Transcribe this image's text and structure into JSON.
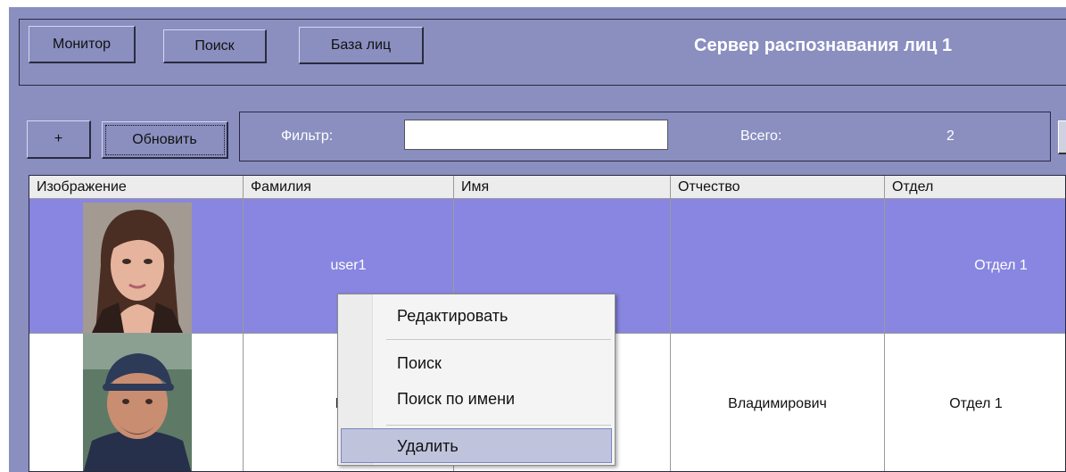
{
  "toolbar": {
    "monitor_label": "Монитор",
    "search_label": "Поиск",
    "face_db_label": "База лиц",
    "server_title": "Сервер распознавания лиц 1"
  },
  "actions": {
    "add_label": "+",
    "refresh_label": "Обновить",
    "filter_label": "Фильтр:",
    "filter_value": "",
    "total_label": "Всего:",
    "total_value": "2"
  },
  "table": {
    "columns": [
      "Изображение",
      "Фамилия",
      "Имя",
      "Отчество",
      "Отдел"
    ],
    "rows": [
      {
        "image": "female-portrait",
        "last_name": "user1",
        "first_name": "",
        "patronymic": "",
        "department": "Отдел 1",
        "selected": true
      },
      {
        "image": "male-portrait",
        "last_name": "Мат",
        "first_name": "",
        "patronymic": "Владимирович",
        "department": "Отдел 1",
        "selected": false
      }
    ]
  },
  "context_menu": {
    "items": [
      "Редактировать",
      "Поиск",
      "Поиск по имени",
      "Удалить"
    ],
    "highlighted": "Удалить"
  },
  "colors": {
    "window_bg": "#8a8fc0",
    "selected_row": "#8886e0",
    "menu_highlight": "#bfc3dc"
  }
}
